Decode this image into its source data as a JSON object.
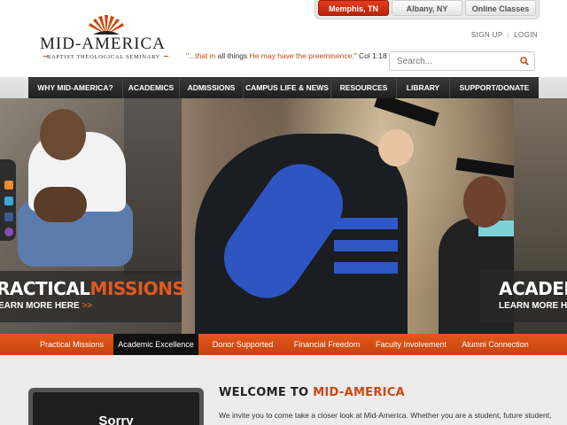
{
  "locations": {
    "tabs": [
      "Memphis, TN",
      "Albany, NY",
      "Online Classes"
    ],
    "active_index": 0
  },
  "logo": {
    "title": "MID-AMERICA",
    "subtitle": "BAPTIST THEOLOGICAL SEMINARY"
  },
  "auth": {
    "signup": "SIGN UP",
    "separator": "|",
    "login": "LOGIN"
  },
  "verse": {
    "open_quote": "\"...that in ",
    "middle": "all things",
    "highlight": " He may have the preeminence.\"",
    "ref": " Col 1:18"
  },
  "search": {
    "placeholder": "Search..."
  },
  "nav": {
    "items": [
      "WHY MID-AMERICA?",
      "ACADEMICS",
      "ADMISSIONS",
      "CAMPUS LIFE & NEWS",
      "RESOURCES",
      "LIBRARY",
      "SUPPORT/DONATE"
    ]
  },
  "hero": {
    "left_caption": {
      "title_white": "RACTICAL",
      "title_orange": "MISSIONS",
      "more_white": "EARN MORE HERE",
      "more_arrow": " >>"
    },
    "right_caption": {
      "title": "ACADEMI",
      "more": "LEARN MORE HERE"
    }
  },
  "social": {
    "icons": [
      "rss-icon",
      "twitter-icon",
      "facebook-icon",
      "podcast-icon"
    ]
  },
  "strip": {
    "items": [
      "Practical Missions",
      "Academic Excellence",
      "Donor Supported",
      "Financial Freedom",
      "Faculty Involvement",
      "Alumni Connection"
    ],
    "active_index": 1
  },
  "welcome": {
    "title_dark": "WELCOME TO ",
    "title_orange": "MID-AMERICA",
    "text": "We invite you to come take a closer look at Mid-America.  Whether you are a student, future student,"
  },
  "video": {
    "text": "Sorry"
  },
  "colors": {
    "accent": "#d0450c",
    "active_tab": "#c9290e",
    "nav_bg": "#2a2a2a"
  }
}
